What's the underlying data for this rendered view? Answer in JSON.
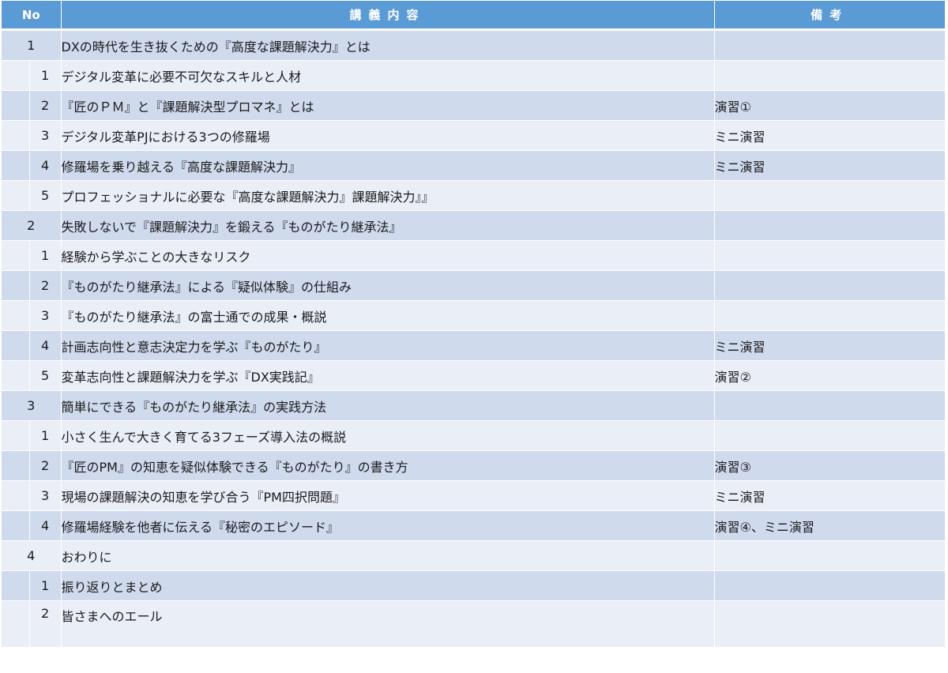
{
  "header": {
    "no": "No",
    "title": "講義内容",
    "note": "備考"
  },
  "rows": [
    {
      "level": 1,
      "no": "1",
      "title": "DXの時代を生き抜くための『高度な課題解決力』とは",
      "note": ""
    },
    {
      "level": 2,
      "no": "1",
      "title": "デジタル変革に必要不可欠なスキルと人材",
      "note": ""
    },
    {
      "level": 2,
      "no": "2",
      "title": "『匠のＰＭ』と『課題解決型プロマネ』とは",
      "note": "演習①"
    },
    {
      "level": 2,
      "no": "3",
      "title": "デジタル変革PJにおける3つの修羅場",
      "note": "ミニ演習"
    },
    {
      "level": 2,
      "no": "4",
      "title": "修羅場を乗り越える『高度な課題解決力』",
      "note": "ミニ演習"
    },
    {
      "level": 2,
      "no": "5",
      "title": "プロフェッショナルに必要な『高度な課題解決力』課題解決力』』",
      "note": ""
    },
    {
      "level": 1,
      "no": "2",
      "title": "失敗しないで『課題解決力』を鍛える『ものがたり継承法』",
      "note": ""
    },
    {
      "level": 2,
      "no": "1",
      "title": "経験から学ぶことの大きなリスク",
      "note": ""
    },
    {
      "level": 2,
      "no": "2",
      "title": "『ものがたり継承法』による『疑似体験』の仕組み",
      "note": ""
    },
    {
      "level": 2,
      "no": "3",
      "title": "『ものがたり継承法』の富士通での成果・概説",
      "note": ""
    },
    {
      "level": 2,
      "no": "4",
      "title": "計画志向性と意志決定力を学ぶ『ものがたり』",
      "note": "ミニ演習"
    },
    {
      "level": 2,
      "no": "5",
      "title": "変革志向性と課題解決力を学ぶ『DX実践記』",
      "note": "演習②"
    },
    {
      "level": 1,
      "no": "3",
      "title": "簡単にできる『ものがたり継承法』の実践方法",
      "note": ""
    },
    {
      "level": 2,
      "no": "1",
      "title": "小さく生んで大きく育てる3フェーズ導入法の概説",
      "note": ""
    },
    {
      "level": 2,
      "no": "2",
      "title": "『匠のPM』の知恵を疑似体験できる『ものがたり』の書き方",
      "note": "演習③"
    },
    {
      "level": 2,
      "no": "3",
      "title": "現場の課題解決の知恵を学び合う『PM四択問題』",
      "note": "ミニ演習"
    },
    {
      "level": 2,
      "no": "4",
      "title": "修羅場経験を他者に伝える『秘密のエピソード』",
      "note": "演習④、ミニ演習"
    },
    {
      "level": 1,
      "no": "4",
      "title": "おわりに",
      "note": ""
    },
    {
      "level": 2,
      "no": "1",
      "title": "振り返りとまとめ",
      "note": ""
    },
    {
      "level": 2,
      "no": "2",
      "title": "皆さまへのエール",
      "note": ""
    }
  ]
}
